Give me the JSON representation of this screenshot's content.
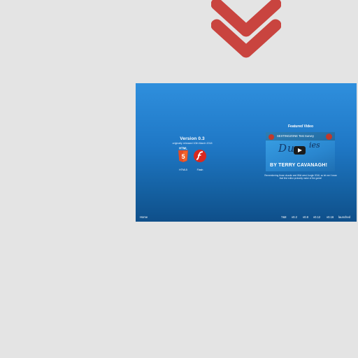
{
  "panel": {
    "version_title": "Version 0.3",
    "version_subtitle": "originally released 10th March 2018",
    "platforms": [
      {
        "label": "HTML5",
        "icon": "html5-icon",
        "badge": "HTML"
      },
      {
        "label": "Flash",
        "icon": "flash-icon"
      }
    ],
    "featured_title": "Featured Video",
    "video": {
      "channel_title": "SEXTINGZONE Test Survey",
      "byline": "BY TERRY CAVANAGH!"
    },
    "caption": "Remembering those chaotic and Wild west Jungle 2016, so let me I know that first editor probably make of the game!"
  },
  "footer": {
    "home": "Home",
    "links": [
      "7&8",
      "v0.2",
      "v0.8",
      "v0.12",
      "v0.16",
      "launched"
    ]
  },
  "colors": {
    "chevron": "#c9443f",
    "panel_top": "#2f8fdd",
    "panel_bottom": "#0f4f8a",
    "html5": "#e44d26",
    "flash": "#d8281f"
  }
}
